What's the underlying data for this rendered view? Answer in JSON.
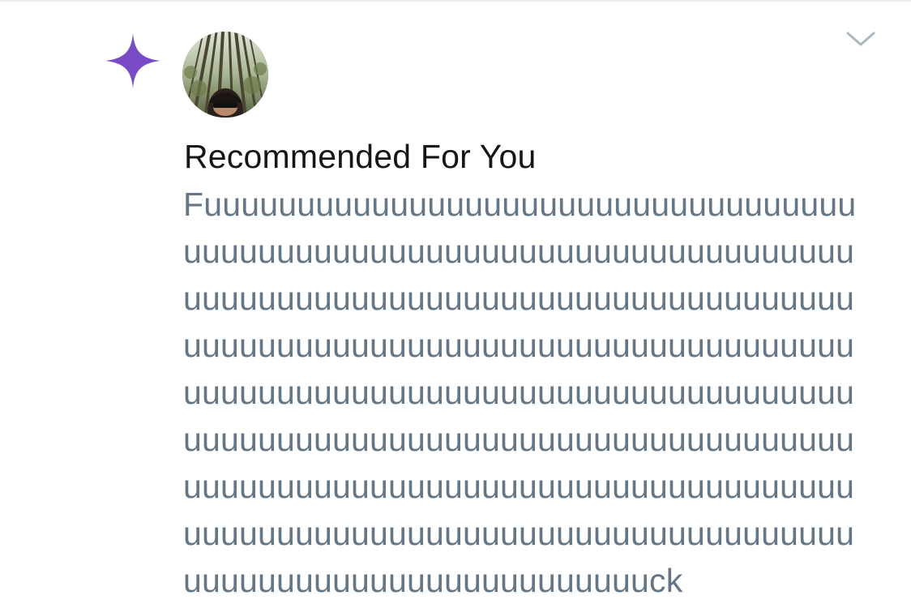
{
  "notification": {
    "type_icon": "sparkle-icon",
    "type_icon_color": "#794bc4",
    "avatar": "user-avatar-forest-photo",
    "menu_icon": "chevron-down-icon",
    "title": "Recommended For You",
    "body": "Fuuuuuuuuuuuuuuuuuuuuuuuuuuuuuuuuuuuuuuuuuuuuuuuuuuuuuuuuuuuuuuuuuuuuuuuuuuuuuuuuuuuuuuuuuuuuuuuuuuuuuuuuuuuuuuuuuuuuuuuuuuuuuuuuuuuuuuuuuuuuuuuuuuuuuuuuuuuuuuuuuuuuuuuuuuuuuuuuuuuuuuuuuuuuuuuuuuuuuuuuuuuuuuuuuuuuuuuuuuuuuuuuuuuuuuuuuuuuuuuuuuuuuuuuuuuuuuuuuuuuuuuuuuuuuuuuuuuuuuuuuuuuuuuuuuuuuuuuuuuuuuuuuuuuuuuuck"
  },
  "colors": {
    "title": "#14171a",
    "body": "#657786",
    "chevron": "#aab8c2",
    "divider": "#e6ecf0"
  }
}
